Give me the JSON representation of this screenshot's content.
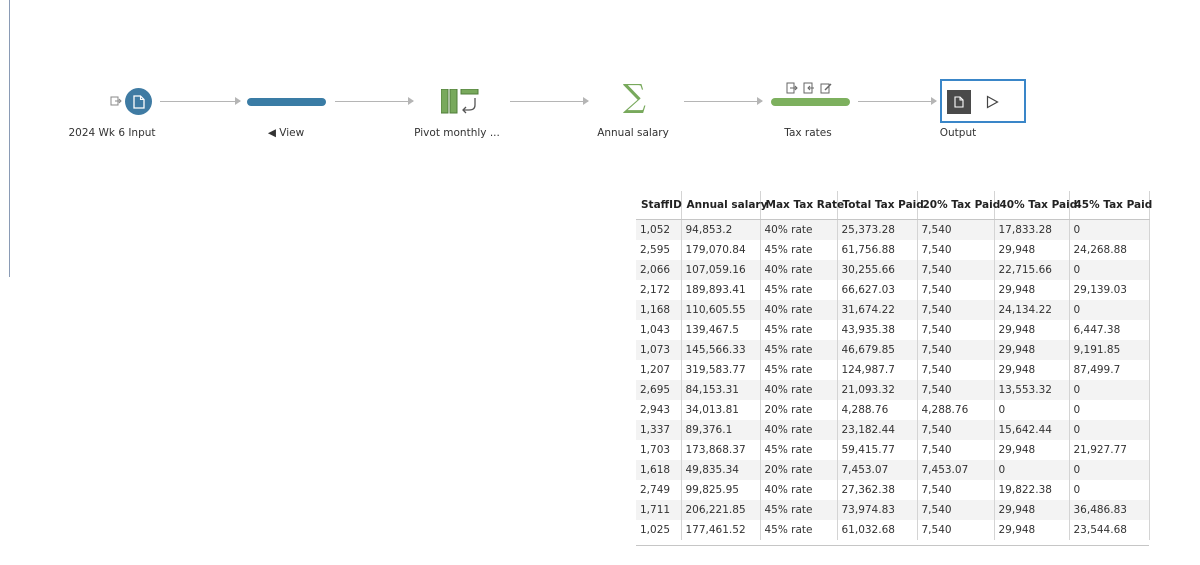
{
  "flow": {
    "nodes": [
      {
        "label": "2024 Wk 6 Input",
        "icon": "document-icon"
      },
      {
        "label": "◀ View",
        "icon": "view-bar"
      },
      {
        "label": "Pivot monthly ...",
        "icon": "pivot-icon"
      },
      {
        "label": "Annual salary",
        "icon": "sigma-icon"
      },
      {
        "label": "Tax rates",
        "icon": "clean-bar"
      },
      {
        "label": "Output",
        "icon": "output-icon"
      }
    ],
    "colors": {
      "input": "#3f7ba3",
      "view": "#3a7ca5",
      "pivot": "#78a95c",
      "selection": "#3a86c8"
    }
  },
  "table": {
    "columns": [
      "StaffID",
      "Annual salary",
      "Max Tax Rate",
      "Total Tax Paid",
      "20% Tax Paid",
      "40% Tax Paid",
      "45% Tax Paid"
    ],
    "rows": [
      [
        "1,052",
        "94,853.2",
        "40% rate",
        "25,373.28",
        "7,540",
        "17,833.28",
        "0"
      ],
      [
        "2,595",
        "179,070.84",
        "45% rate",
        "61,756.88",
        "7,540",
        "29,948",
        "24,268.88"
      ],
      [
        "2,066",
        "107,059.16",
        "40% rate",
        "30,255.66",
        "7,540",
        "22,715.66",
        "0"
      ],
      [
        "2,172",
        "189,893.41",
        "45% rate",
        "66,627.03",
        "7,540",
        "29,948",
        "29,139.03"
      ],
      [
        "1,168",
        "110,605.55",
        "40% rate",
        "31,674.22",
        "7,540",
        "24,134.22",
        "0"
      ],
      [
        "1,043",
        "139,467.5",
        "45% rate",
        "43,935.38",
        "7,540",
        "29,948",
        "6,447.38"
      ],
      [
        "1,073",
        "145,566.33",
        "45% rate",
        "46,679.85",
        "7,540",
        "29,948",
        "9,191.85"
      ],
      [
        "1,207",
        "319,583.77",
        "45% rate",
        "124,987.7",
        "7,540",
        "29,948",
        "87,499.7"
      ],
      [
        "2,695",
        "84,153.31",
        "40% rate",
        "21,093.32",
        "7,540",
        "13,553.32",
        "0"
      ],
      [
        "2,943",
        "34,013.81",
        "20% rate",
        "4,288.76",
        "4,288.76",
        "0",
        "0"
      ],
      [
        "1,337",
        "89,376.1",
        "40% rate",
        "23,182.44",
        "7,540",
        "15,642.44",
        "0"
      ],
      [
        "1,703",
        "173,868.37",
        "45% rate",
        "59,415.77",
        "7,540",
        "29,948",
        "21,927.77"
      ],
      [
        "1,618",
        "49,835.34",
        "20% rate",
        "7,453.07",
        "7,453.07",
        "0",
        "0"
      ],
      [
        "2,749",
        "99,825.95",
        "40% rate",
        "27,362.38",
        "7,540",
        "19,822.38",
        "0"
      ],
      [
        "1,711",
        "206,221.85",
        "45% rate",
        "73,974.83",
        "7,540",
        "29,948",
        "36,486.83"
      ],
      [
        "1,025",
        "177,461.52",
        "45% rate",
        "61,032.68",
        "7,540",
        "29,948",
        "23,544.68"
      ]
    ]
  }
}
